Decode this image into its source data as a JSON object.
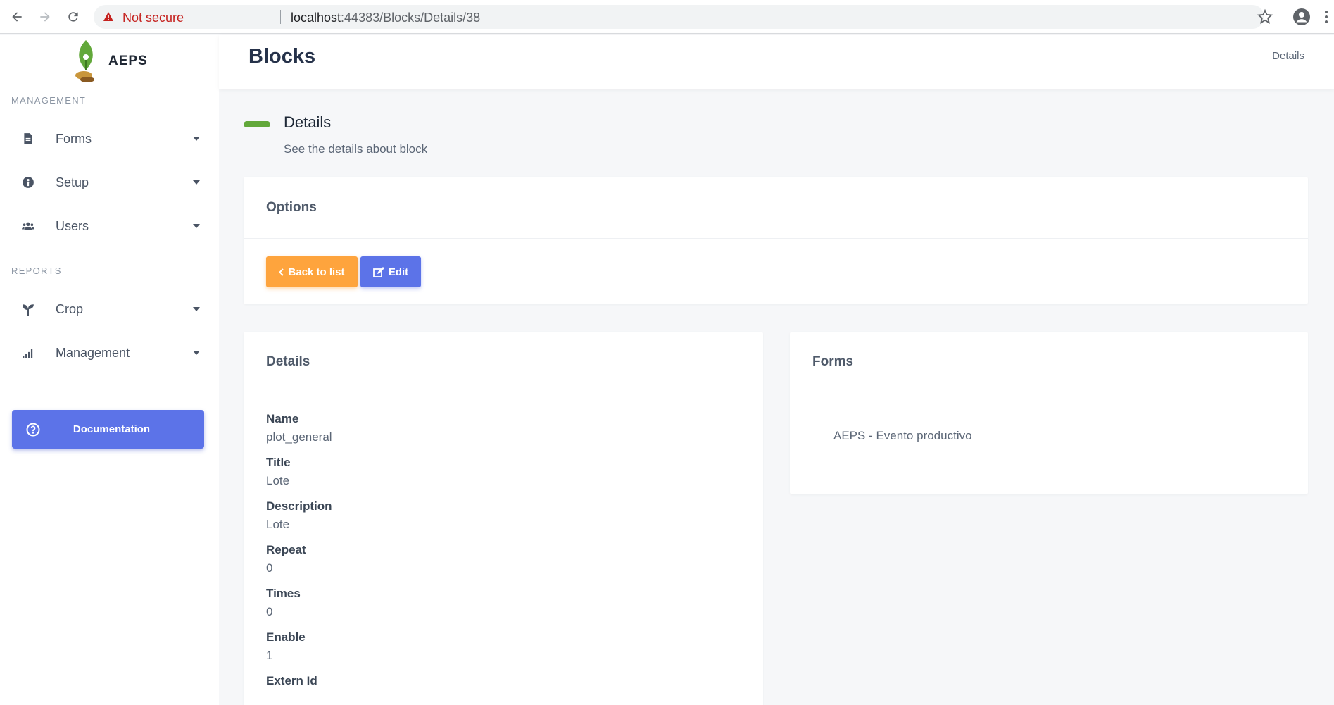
{
  "browser": {
    "not_secure": "Not secure",
    "url_host": "localhost",
    "url_path": ":44383/Blocks/Details/38"
  },
  "sidebar": {
    "brand": "AEPS",
    "management_label": "MANAGEMENT",
    "reports_label": "REPORTS",
    "management_items": [
      {
        "label": "Forms",
        "icon": "file-icon"
      },
      {
        "label": "Setup",
        "icon": "setup-icon"
      },
      {
        "label": "Users",
        "icon": "users-icon"
      }
    ],
    "report_items": [
      {
        "label": "Crop",
        "icon": "seedling-icon"
      },
      {
        "label": "Management",
        "icon": "signal-icon"
      }
    ],
    "documentation": "Documentation"
  },
  "header": {
    "title": "Blocks",
    "breadcrumb": "Details"
  },
  "section": {
    "title": "Details",
    "subtitle": "See the details about block"
  },
  "options": {
    "title": "Options",
    "back_label": "Back to list",
    "edit_label": "Edit"
  },
  "details": {
    "title": "Details",
    "fields": [
      {
        "label": "Name",
        "value": "plot_general"
      },
      {
        "label": "Title",
        "value": "Lote"
      },
      {
        "label": "Description",
        "value": "Lote"
      },
      {
        "label": "Repeat",
        "value": "0"
      },
      {
        "label": "Times",
        "value": "0"
      },
      {
        "label": "Enable",
        "value": "1"
      },
      {
        "label": "Extern Id",
        "value": ""
      }
    ]
  },
  "forms": {
    "title": "Forms",
    "items": [
      "AEPS - Evento productivo"
    ]
  },
  "colors": {
    "accent_green": "#62a83a",
    "primary": "#5c73e8",
    "warning": "#fea43d"
  }
}
